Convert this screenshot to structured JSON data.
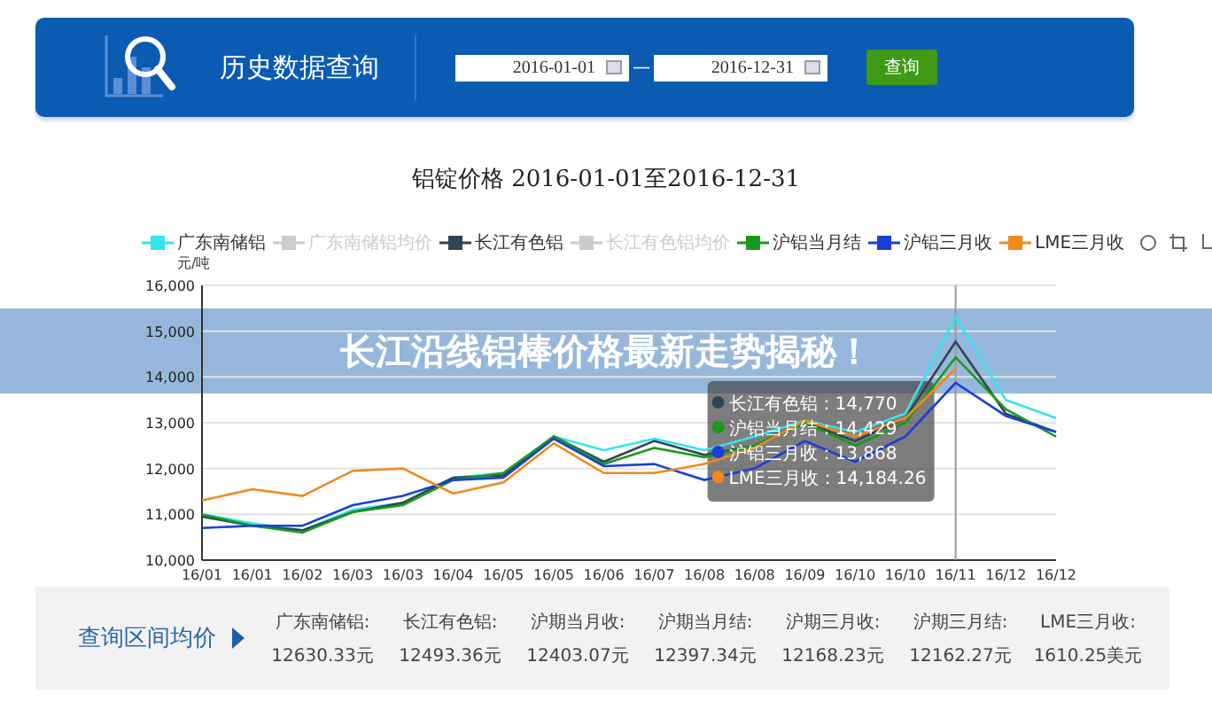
{
  "header": {
    "title": "历史数据查询",
    "start_date": "2016-01-01",
    "separator": "—",
    "end_date": "2016-12-31",
    "button": "查询"
  },
  "chart": {
    "title": "铝锭价格  2016-01-01至2016-12-31",
    "legend": [
      {
        "kind": "series"
      },
      {
        "kind": "inactive",
        "name": "广东南储铝均价",
        "color": "#cccccc"
      },
      {
        "kind": "series"
      },
      {
        "kind": "inactive",
        "name": "长江有色铝均价",
        "color": "#cccccc"
      },
      {
        "kind": "series"
      },
      {
        "kind": "series"
      },
      {
        "kind": "series"
      }
    ],
    "y_unit": "元/吨",
    "chart_data": {
      "type": "line",
      "grid": true,
      "categories": [
        "16/01",
        "16/01",
        "16/02",
        "16/03",
        "16/03",
        "16/04",
        "16/05",
        "16/05",
        "16/06",
        "16/07",
        "16/08",
        "16/08",
        "16/09",
        "16/10",
        "16/10",
        "16/11",
        "16/12",
        "16/12"
      ],
      "series": [
        {
          "name": "广东南储铝",
          "color": "#33e3ee",
          "values": [
            11000,
            10800,
            10650,
            11100,
            11250,
            11800,
            11900,
            12700,
            12400,
            12650,
            12400,
            12700,
            13050,
            12800,
            13200,
            15300,
            13500,
            13100
          ]
        },
        {
          "name": "长江有色铝",
          "color": "#2f4554",
          "values": [
            10950,
            10750,
            10650,
            11050,
            11250,
            11800,
            11850,
            12700,
            12150,
            12600,
            12300,
            12500,
            13000,
            12600,
            13100,
            14770,
            13200,
            12800
          ]
        },
        {
          "name": "沪铝当月结",
          "color": "#1a9a1a",
          "values": [
            11000,
            10750,
            10600,
            11050,
            11200,
            11750,
            11900,
            12700,
            12100,
            12450,
            12250,
            12500,
            13000,
            12500,
            13000,
            14430,
            13300,
            12700
          ]
        },
        {
          "name": "沪铝三月收",
          "color": "#1a3fd6",
          "values": [
            10700,
            10750,
            10750,
            11200,
            11400,
            11750,
            11800,
            12650,
            12050,
            12100,
            11750,
            12000,
            12600,
            12150,
            12700,
            13870,
            13150,
            12800
          ]
        },
        {
          "name": "LME三月收",
          "color": "#f08a1c",
          "values": [
            11300,
            11550,
            11400,
            11950,
            12000,
            11450,
            11700,
            12550,
            11900,
            11900,
            12100,
            12450,
            13050,
            12700,
            13100,
            14180,
            null,
            null
          ]
        }
      ],
      "ylim": [
        10000,
        16000
      ],
      "yticks": [
        {
          "value": 10000,
          "label": "10,000"
        },
        {
          "value": 11000,
          "label": "11,000"
        },
        {
          "value": 12000,
          "label": "12,000"
        },
        {
          "value": 13000,
          "label": "13,000"
        },
        {
          "value": 14000,
          "label": "14,000"
        },
        {
          "value": 15000,
          "label": "15,000"
        },
        {
          "value": 16000,
          "label": "16,000"
        }
      ],
      "ref_lines": [
        {
          "axis": "x",
          "value": "16/11"
        }
      ]
    },
    "tooltip": {
      "items": [
        {
          "label": "长江有色铝：",
          "value": "14,770",
          "color": "#2f4554"
        },
        {
          "label": "沪铝当月结：",
          "value": "14,429",
          "color": "#1a9a1a"
        },
        {
          "label": "沪铝三月收：",
          "value": "13,868",
          "color": "#1a3fd6"
        },
        {
          "label": "LME三月收：",
          "value": "14,184.26",
          "color": "#f08a1c"
        }
      ]
    }
  },
  "banner": {
    "text": "长江沿线铝棒价格最新走势揭秘！"
  },
  "summary": {
    "label": "查询区间均价",
    "items": [
      {
        "name": "广东南储铝:",
        "value": "12630.33元"
      },
      {
        "name": "长江有色铝:",
        "value": "12493.36元"
      },
      {
        "name": "沪期当月收:",
        "value": "12403.07元"
      },
      {
        "name": "沪期当月结:",
        "value": "12397.34元"
      },
      {
        "name": "沪期三月收:",
        "value": "12168.23元"
      },
      {
        "name": "沪期三月结:",
        "value": "12162.27元"
      },
      {
        "name": "LME三月收:",
        "value": "1610.25美元"
      }
    ]
  }
}
